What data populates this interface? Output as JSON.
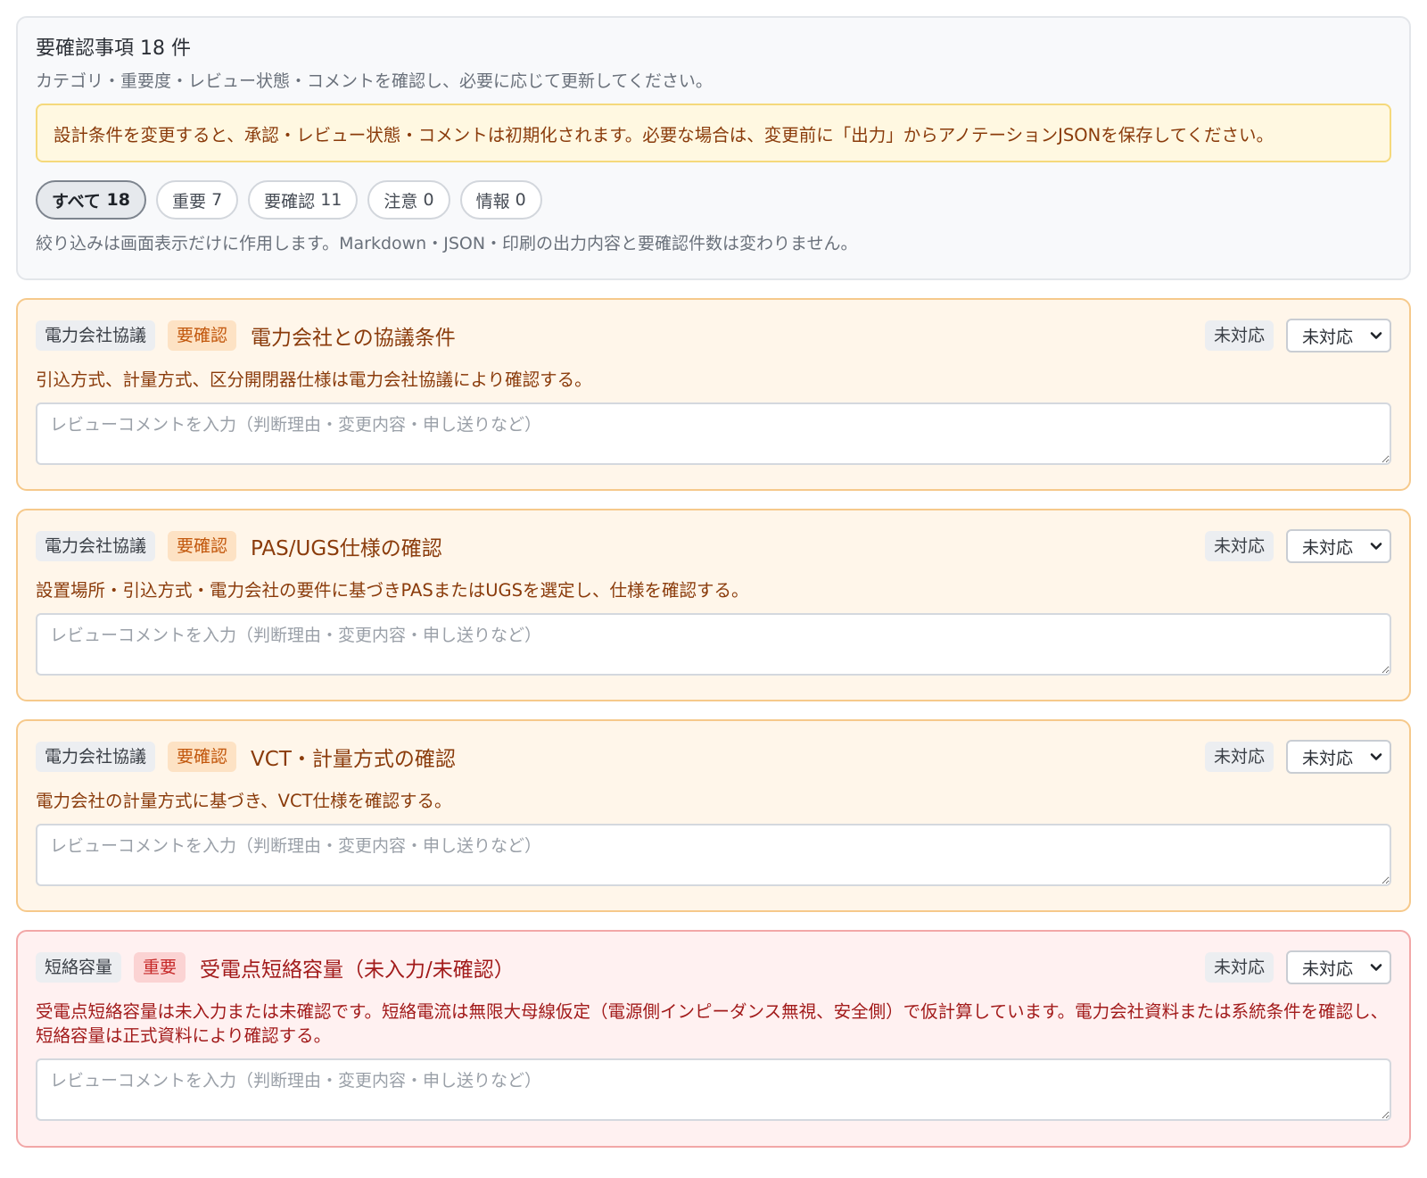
{
  "summary": {
    "title": "要確認事項 18 件",
    "subtitle": "カテゴリ・重要度・レビュー状態・コメントを確認し、必要に応じて更新してください。",
    "warning": "設計条件を変更すると、承認・レビュー状態・コメントは初期化されます。必要な場合は、変更前に「出力」からアノテーションJSONを保存してください。",
    "filters": [
      {
        "label": "すべて",
        "count": "18",
        "active": true
      },
      {
        "label": "重要",
        "count": "7",
        "active": false
      },
      {
        "label": "要確認",
        "count": "11",
        "active": false
      },
      {
        "label": "注意",
        "count": "0",
        "active": false
      },
      {
        "label": "情報",
        "count": "0",
        "active": false
      }
    ],
    "filter_note": "絞り込みは画面表示だけに作用します。Markdown・JSON・印刷の出力内容と要確認件数は変わりません。"
  },
  "comment_placeholder": "レビューコメントを入力（判断理由・変更内容・申し送りなど）",
  "items": [
    {
      "category": "電力会社協議",
      "severity": "要確認",
      "title": "電力会社との協議条件",
      "status_badge": "未対応",
      "status_select": "未対応",
      "description": "引込方式、計量方式、区分開閉器仕様は電力会社協議により確認する。"
    },
    {
      "category": "電力会社協議",
      "severity": "要確認",
      "title": "PAS/UGS仕様の確認",
      "status_badge": "未対応",
      "status_select": "未対応",
      "description": "設置場所・引込方式・電力会社の要件に基づきPASまたはUGSを選定し、仕様を確認する。"
    },
    {
      "category": "電力会社協議",
      "severity": "要確認",
      "title": "VCT・計量方式の確認",
      "status_badge": "未対応",
      "status_select": "未対応",
      "description": "電力会社の計量方式に基づき、VCT仕様を確認する。"
    },
    {
      "category": "短絡容量",
      "severity": "重要",
      "title": "受電点短絡容量（未入力/未確認）",
      "status_badge": "未対応",
      "status_select": "未対応",
      "description": "受電点短絡容量は未入力または未確認です。短絡電流は無限大母線仮定（電源側インピーダンス無視、安全側）で仮計算しています。電力会社資料または系統条件を確認し、短絡容量は正式資料により確認する。"
    }
  ]
}
